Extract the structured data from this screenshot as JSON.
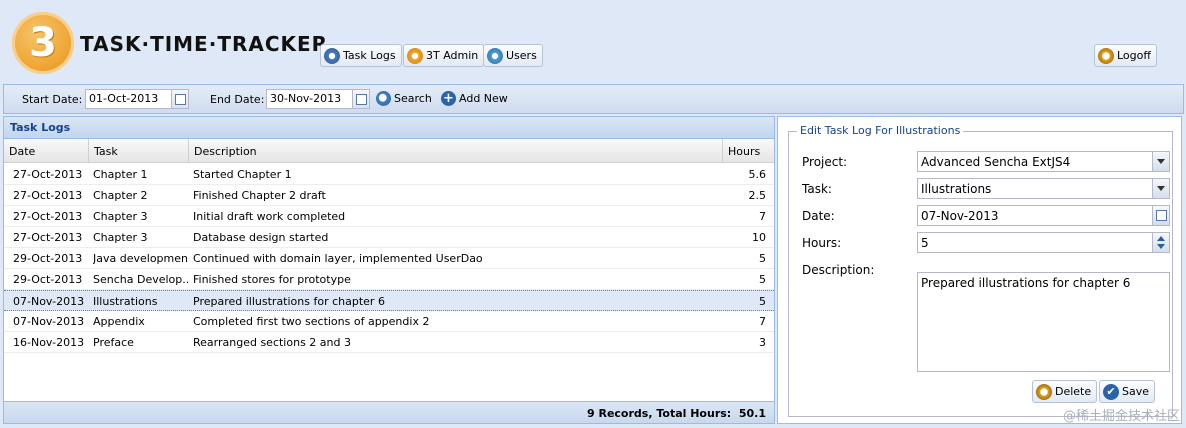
{
  "header": {
    "logo_mark": "3",
    "app_title": "TASK·TIME·TRACKER",
    "nav": {
      "task_logs": "Task Logs",
      "admin": "3T Admin",
      "users": "Users"
    },
    "logoff": "Logoff"
  },
  "toolbar": {
    "start_date_label": "Start Date:",
    "start_date_value": "01-Oct-2013",
    "end_date_label": "End Date:",
    "end_date_value": "30-Nov-2013",
    "search_label": "Search",
    "add_new_label": "Add New"
  },
  "grid": {
    "title": "Task Logs",
    "columns": {
      "date": "Date",
      "task": "Task",
      "description": "Description",
      "hours": "Hours"
    },
    "rows": [
      {
        "date": "27-Oct-2013",
        "task": "Chapter 1",
        "description": "Started Chapter 1",
        "hours": "5.6"
      },
      {
        "date": "27-Oct-2013",
        "task": "Chapter 2",
        "description": "Finished Chapter 2 draft",
        "hours": "2.5"
      },
      {
        "date": "27-Oct-2013",
        "task": "Chapter 3",
        "description": "Initial draft work completed",
        "hours": "7"
      },
      {
        "date": "27-Oct-2013",
        "task": "Chapter 3",
        "description": "Database design started",
        "hours": "10"
      },
      {
        "date": "29-Oct-2013",
        "task": "Java development",
        "description": "Continued with domain layer, implemented UserDao",
        "hours": "5"
      },
      {
        "date": "29-Oct-2013",
        "task": "Sencha Develop...",
        "description": "Finished stores for prototype",
        "hours": "5"
      },
      {
        "date": "07-Nov-2013",
        "task": "Illustrations",
        "description": "Prepared illustrations for chapter 6",
        "hours": "5",
        "selected": true
      },
      {
        "date": "07-Nov-2013",
        "task": "Appendix",
        "description": "Completed first two sections of appendix 2",
        "hours": "7"
      },
      {
        "date": "16-Nov-2013",
        "task": "Preface",
        "description": "Rearranged sections 2 and 3",
        "hours": "3"
      }
    ],
    "footer_label": "9 Records, Total Hours:",
    "footer_total": "50.1"
  },
  "form": {
    "legend": "Edit Task Log For Illustrations",
    "project_label": "Project:",
    "project_value": "Advanced Sencha ExtJS4",
    "task_label": "Task:",
    "task_value": "Illustrations",
    "date_label": "Date:",
    "date_value": "07-Nov-2013",
    "hours_label": "Hours:",
    "hours_value": "5",
    "description_label": "Description:",
    "description_value": "Prepared illustrations for chapter 6",
    "delete_label": "Delete",
    "save_label": "Save"
  },
  "watermark": "@稀土掘金技术社区",
  "icons": {
    "task_logs": "list-icon",
    "admin": "gear-icon",
    "users": "users-icon",
    "logoff": "power-icon",
    "search": "search-icon",
    "add": "plus-icon",
    "delete": "delete-icon",
    "save": "checkmark-icon"
  }
}
